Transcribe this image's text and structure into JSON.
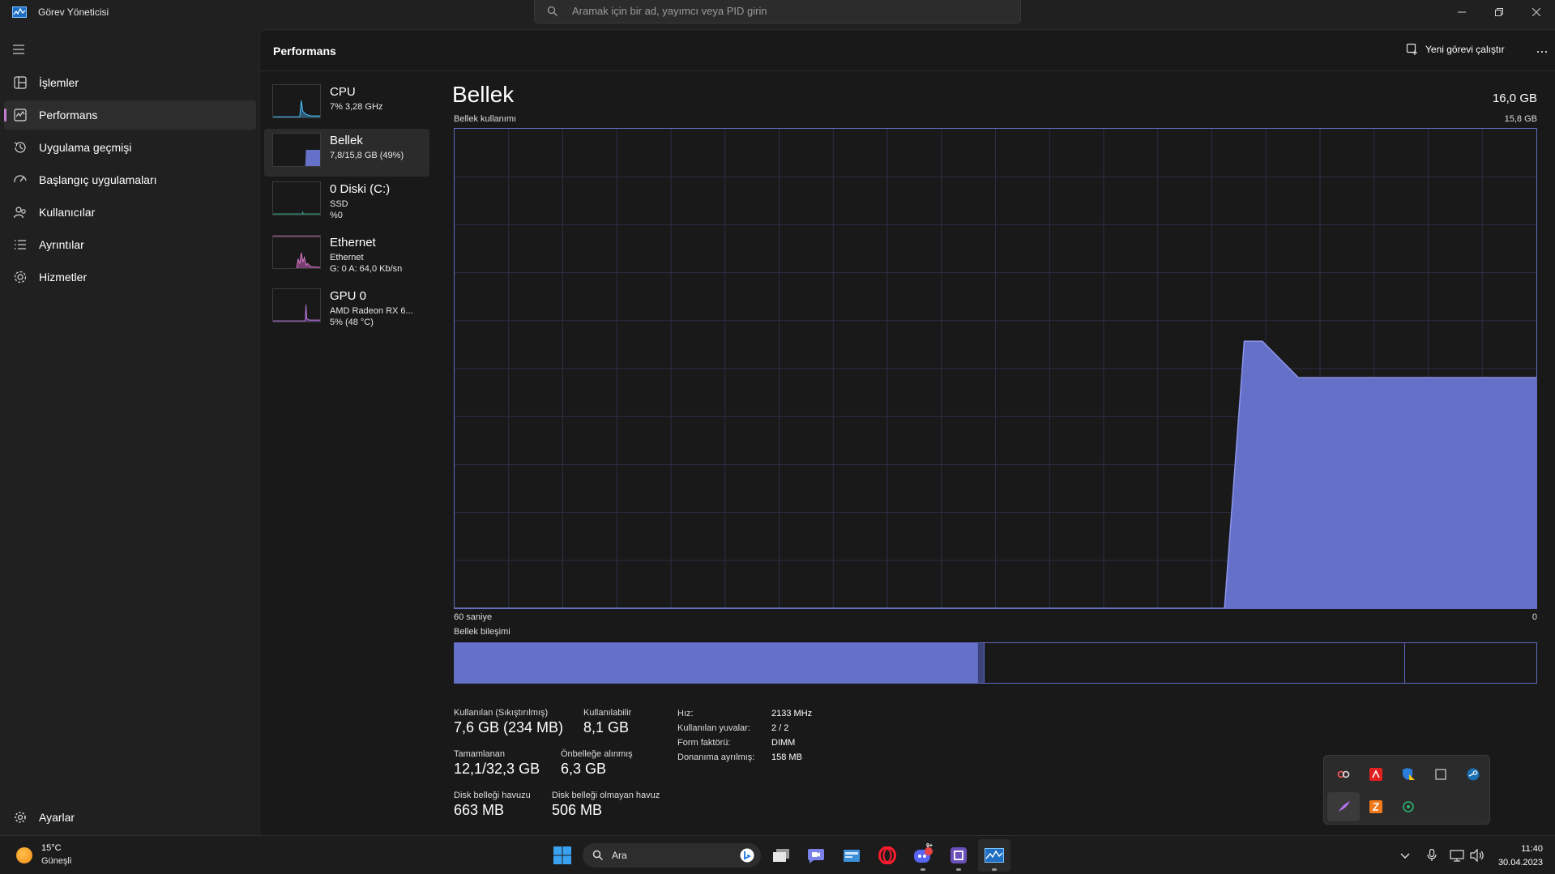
{
  "window": {
    "title": "Görev Yöneticisi",
    "search_placeholder": "Aramak için bir ad, yayımcı veya PID girin"
  },
  "sidebar": {
    "items": [
      {
        "label": "İşlemler",
        "icon": "processes-icon"
      },
      {
        "label": "Performans",
        "icon": "performance-icon",
        "active": true
      },
      {
        "label": "Uygulama geçmişi",
        "icon": "app-history-icon"
      },
      {
        "label": "Başlangıç uygulamaları",
        "icon": "startup-apps-icon"
      },
      {
        "label": "Kullanıcılar",
        "icon": "users-icon"
      },
      {
        "label": "Ayrıntılar",
        "icon": "details-icon"
      },
      {
        "label": "Hizmetler",
        "icon": "services-icon"
      }
    ],
    "settings_label": "Ayarlar"
  },
  "header": {
    "title": "Performans",
    "run_task_label": "Yeni görevi çalıştır",
    "more_label": "..."
  },
  "devices": [
    {
      "name": "CPU",
      "sub1": "7% 3,28 GHz",
      "sub2": "",
      "color": "#4cc2ff"
    },
    {
      "name": "Bellek",
      "sub1": "7,8/15,8 GB (49%)",
      "sub2": "",
      "color": "#7b86e0",
      "active": true
    },
    {
      "name": "0 Diski (C:)",
      "sub1": "SSD",
      "sub2": "%0",
      "color": "#3ec6a8"
    },
    {
      "name": "Ethernet",
      "sub1": "Ethernet",
      "sub2": "G: 0 A: 64,0 Kb/sn",
      "color": "#d67bc8"
    },
    {
      "name": "GPU 0",
      "sub1": "AMD Radeon RX 6...",
      "sub2": "5% (48 °C)",
      "color": "#b77bdc"
    }
  ],
  "memory": {
    "title": "Bellek",
    "total": "16,0 GB",
    "usage_label": "Bellek kullanımı",
    "usage_max": "15,8 GB",
    "axis_left": "60 saniye",
    "axis_right": "0",
    "composition_label": "Bellek bileşimi",
    "stats": {
      "in_use_label": "Kullanılan (Sıkıştırılmış)",
      "in_use_value": "7,6 GB (234 MB)",
      "available_label": "Kullanılabilir",
      "available_value": "8,1 GB",
      "committed_label": "Tamamlanan",
      "committed_value": "12,1/32,3 GB",
      "cached_label": "Önbelleğe alınmış",
      "cached_value": "6,3 GB",
      "paged_label": "Disk belleği havuzu",
      "paged_value": "663 MB",
      "nonpaged_label": "Disk belleği olmayan havuz",
      "nonpaged_value": "506 MB"
    },
    "specs": {
      "speed_label": "Hız:",
      "speed_value": "2133 MHz",
      "slots_label": "Kullanılan yuvalar:",
      "slots_value": "2 / 2",
      "form_label": "Form faktörü:",
      "form_value": "DIMM",
      "reserved_label": "Donanıma ayrılmış:",
      "reserved_value": "158 MB"
    },
    "accent_color": "#5f6bbf",
    "fill_color": "#6570c9"
  },
  "chart_data": {
    "type": "area",
    "xlabel": "60 saniye",
    "xlim": [
      60,
      0
    ],
    "ylim": [
      0,
      15.8
    ],
    "x": [
      60,
      17.3,
      16.2,
      15.2,
      13.2,
      11.0,
      9.0,
      0
    ],
    "values": [
      0,
      0,
      8.8,
      8.8,
      7.6,
      7.6,
      7.6,
      7.6
    ],
    "composition": {
      "in_use": 0.483,
      "modified": 0.006,
      "standby": 0.389,
      "free": 0.122
    }
  },
  "taskbar": {
    "weather_temp": "15°C",
    "weather_desc": "Güneşli",
    "search_label": "Ara",
    "clock_time": "11:40",
    "clock_date": "30.04.2023",
    "discord_badge": "9+"
  }
}
